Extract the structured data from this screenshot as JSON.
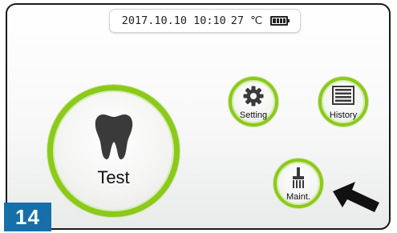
{
  "status_bar": {
    "datetime": "2017.10.10 10:10",
    "temperature": "27 ℃",
    "battery_icon": "battery-full-icon"
  },
  "buttons": {
    "test": {
      "label": "Test",
      "icon": "tooth-icon"
    },
    "setting": {
      "label": "Setting",
      "icon": "gear-icon"
    },
    "history": {
      "label": "History",
      "icon": "list-icon"
    },
    "maintenance": {
      "label": "Maint.",
      "icon": "brush-icon"
    }
  },
  "pointer": {
    "icon": "pointer-arrow-icon"
  },
  "page_number": "14",
  "colors": {
    "accent_ring": "#8bc91b",
    "badge": "#176fa9"
  }
}
